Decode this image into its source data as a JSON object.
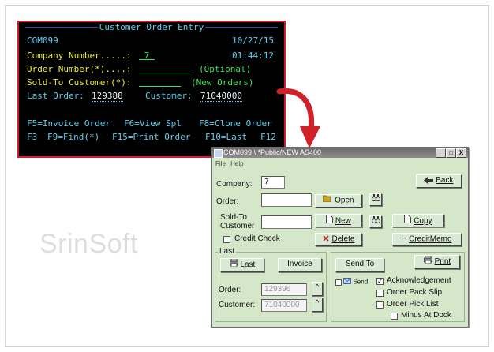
{
  "terminal": {
    "title": "Customer Order Entry",
    "program": "COM099",
    "date": "10/27/15",
    "time": "01:44:12",
    "company_label": "Company Number.....:",
    "company_value": "7",
    "order_label": "Order Number(*)....:",
    "order_hint": "(Optional)",
    "soldto_label": "Sold-To Customer(*):",
    "soldto_hint": "(New Orders)",
    "last_order_label": "Last Order:",
    "last_order_value": "129388",
    "customer_label": "Customer:",
    "customer_value": "71040000",
    "fkeys_row1": [
      "F5=Invoice Order",
      "F6=View Spl",
      "F8=Clone Order"
    ],
    "fkeys_row2": [
      "F3",
      "F9=Find(*)",
      "F15=Print Order",
      "F10=Last",
      "F12"
    ]
  },
  "watermark": "SrinSoft",
  "window": {
    "title": "COM099 \\ *Public/NEW AS400",
    "minimize": "_",
    "maximize": "□",
    "close": "X",
    "menu": [
      "File",
      "Help"
    ],
    "company_label": "Company:",
    "company_value": "7",
    "order_label": "Order:",
    "soldto_label_1": "Sold-To",
    "soldto_label_2": "Customer",
    "credit_check_label": "Credit Check",
    "buttons": {
      "back": "Back",
      "open": "Open",
      "new": "New",
      "copy": "Copy",
      "delete": "Delete",
      "credit_memo": "CreditMemo",
      "last": "Last",
      "invoice": "Invoice",
      "send_to": "Send To",
      "print": "Print"
    },
    "last_group_label": "Last",
    "last_order_label": "Order:",
    "last_order_value": "129396",
    "last_customer_label": "Customer:",
    "last_customer_value": "71040000",
    "spin_glyph": "^",
    "send_label": "Send",
    "options": [
      {
        "label": "Acknowledgement",
        "checked": true
      },
      {
        "label": "Order Pack Slip",
        "checked": false
      },
      {
        "label": "Order Pick List",
        "checked": false
      },
      {
        "label": "Minus At Dock",
        "checked": false
      }
    ]
  },
  "colors": {
    "terminal_bg": "#000000",
    "terminal_border": "#d21b2b",
    "terminal_text_cyan": "#5cd1f0",
    "terminal_text_yellow": "#e9ec43",
    "terminal_text_green": "#41e25a",
    "window_bg": "#d4e8c9",
    "arrow": "#d0202a"
  }
}
